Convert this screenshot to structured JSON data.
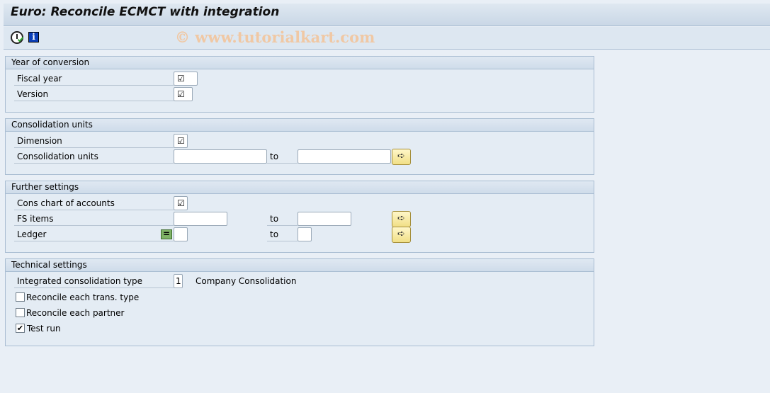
{
  "title": "Euro: Reconcile ECMCT with integration",
  "toolbar": {
    "execute_icon": "clock-check-icon",
    "info_icon": "info-icon"
  },
  "watermark": "© www.tutorialkart.com",
  "sections": {
    "year": {
      "title": "Year of conversion",
      "fiscal_year": {
        "label": "Fiscal year",
        "value": "☑"
      },
      "version": {
        "label": "Version",
        "value": "☑"
      }
    },
    "units": {
      "title": "Consolidation units",
      "dimension": {
        "label": "Dimension",
        "value": "☑"
      },
      "cons_units": {
        "label": "Consolidation units",
        "from": "",
        "to_label": "to",
        "to": ""
      }
    },
    "further": {
      "title": "Further settings",
      "chart": {
        "label": "Cons chart of accounts",
        "value": "☑"
      },
      "fs_items": {
        "label": "FS items",
        "from": "",
        "to_label": "to",
        "to": ""
      },
      "ledger": {
        "label": "Ledger",
        "from": "",
        "to_label": "to",
        "to": ""
      }
    },
    "technical": {
      "title": "Technical settings",
      "cons_type": {
        "label": "Integrated consolidation type",
        "value": "1",
        "description": "Company Consolidation"
      },
      "reconcile_trans": {
        "label": "Reconcile each trans. type",
        "checked": false
      },
      "reconcile_partner": {
        "label": "Reconcile each partner",
        "checked": false
      },
      "test_run": {
        "label": "Test run",
        "checked": true,
        "mark": "✔"
      }
    }
  }
}
